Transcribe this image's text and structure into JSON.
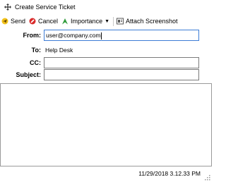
{
  "window": {
    "title": "Create Service Ticket"
  },
  "toolbar": {
    "send_label": "Send",
    "cancel_label": "Cancel",
    "importance_label": "Importance",
    "attach_label": "Attach Screenshot"
  },
  "form": {
    "from_label": "From:",
    "from_value": "user@company.com",
    "to_label": "To:",
    "to_value": "Help Desk",
    "cc_label": "CC:",
    "cc_value": "",
    "subject_label": "Subject:",
    "subject_value": ""
  },
  "status": {
    "timestamp": "11/29/2018 3.12.33 PM"
  },
  "colors": {
    "send_accent": "#f2c21b",
    "cancel_accent": "#d92b2b",
    "importance_accent": "#2e9b3a",
    "focus_border": "#3d7dd6"
  }
}
